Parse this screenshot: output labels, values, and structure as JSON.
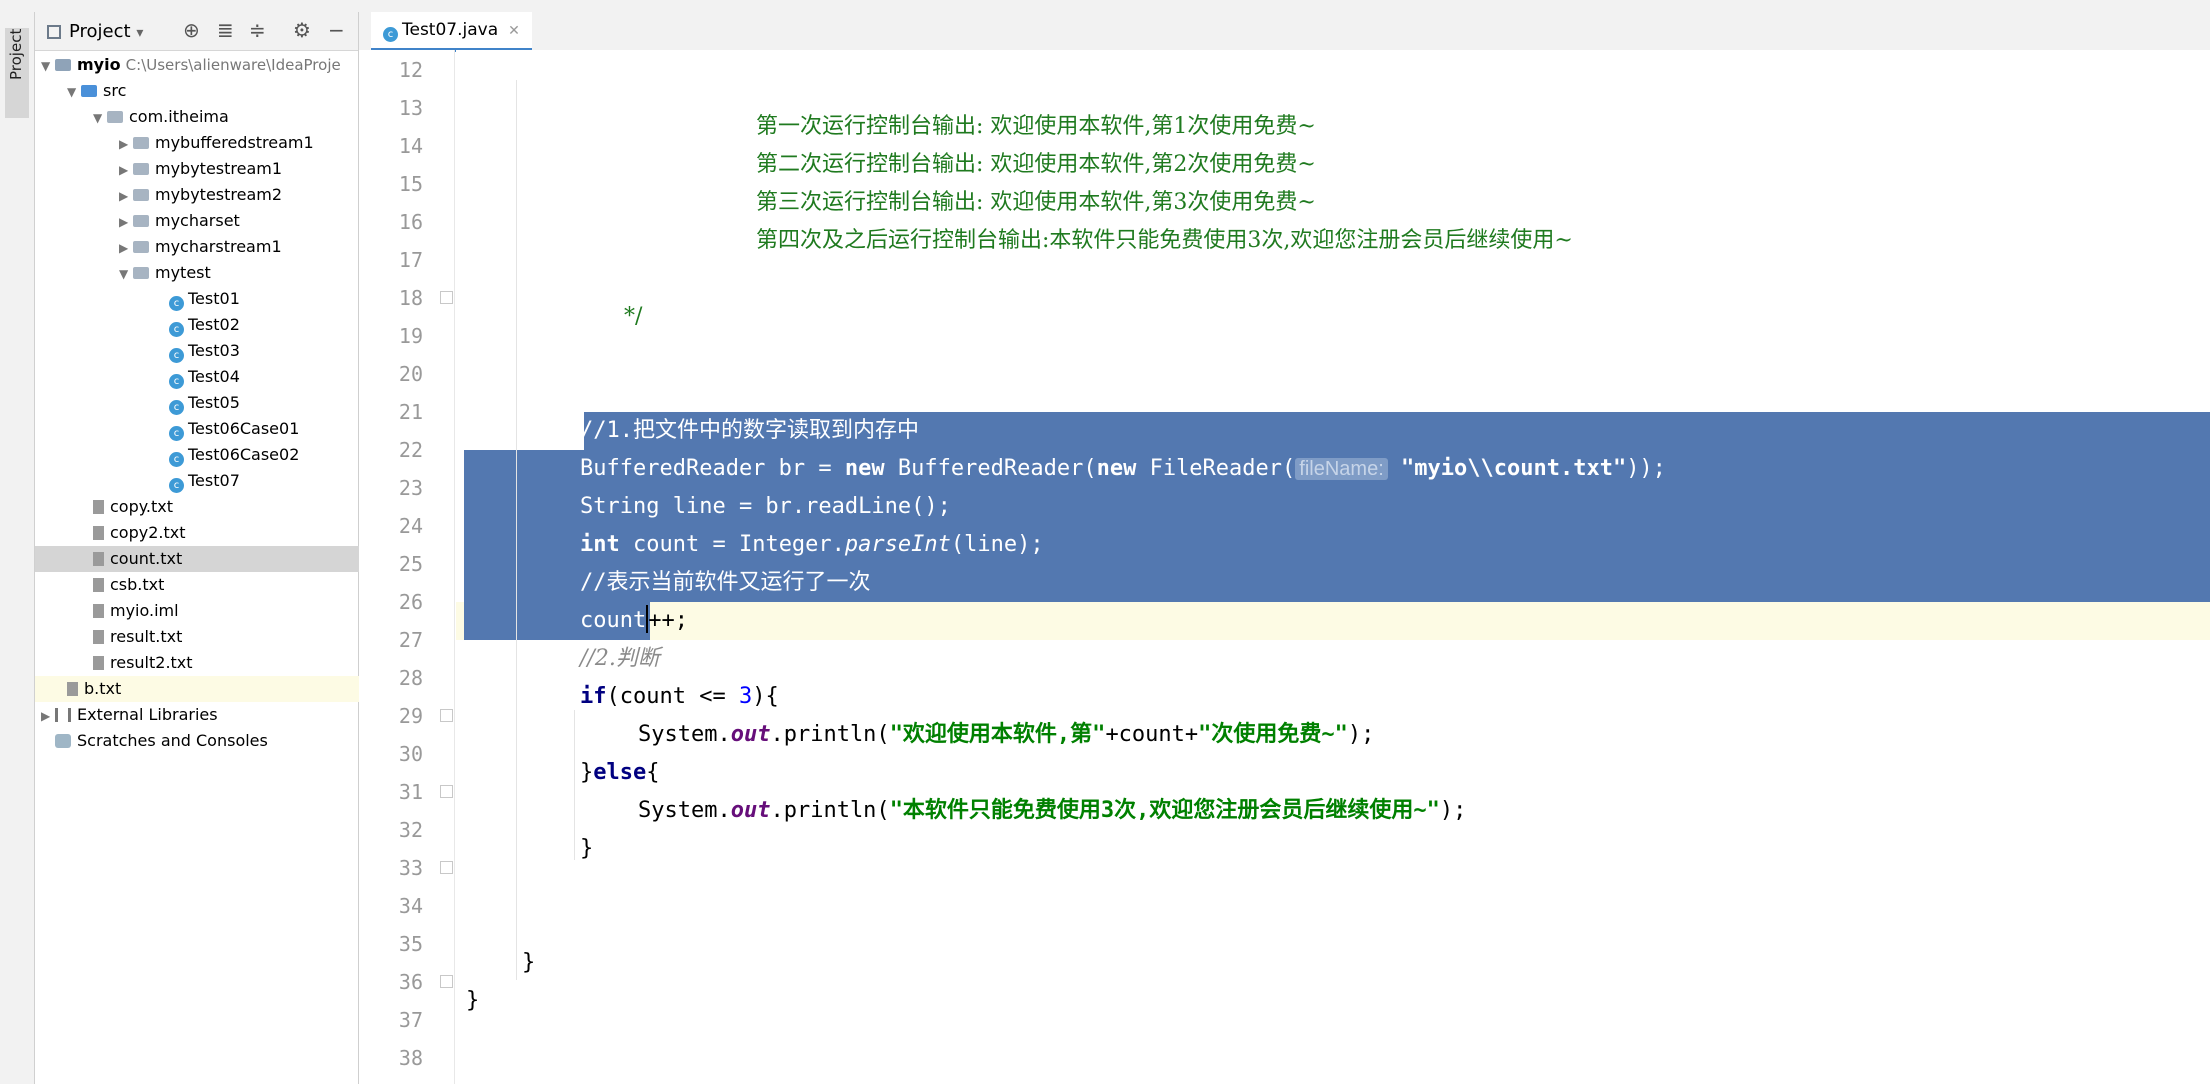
{
  "toolbar": {
    "title": "Project",
    "dropdown_glyph": "▾",
    "icons": [
      "locate-icon",
      "expand-all-icon",
      "collapse-all-icon",
      "gear-icon",
      "minimize-icon"
    ]
  },
  "side_tab": {
    "label": "Project"
  },
  "tree": {
    "root": {
      "name": "myio",
      "path": "C:\\Users\\alienware\\IdeaProje"
    },
    "src": "src",
    "package": "com.itheima",
    "subpackages": [
      "mybufferedstream1",
      "mybytestream1",
      "mybytestream2",
      "mycharset",
      "mycharstream1",
      "mytest"
    ],
    "classes": [
      "Test01",
      "Test02",
      "Test03",
      "Test04",
      "Test05",
      "Test06Case01",
      "Test06Case02",
      "Test07"
    ],
    "files": [
      "copy.txt",
      "copy2.txt",
      "count.txt",
      "csb.txt",
      "myio.iml",
      "result.txt",
      "result2.txt"
    ],
    "b_file": "b.txt",
    "external_libraries": "External Libraries",
    "scratches": "Scratches and Consoles"
  },
  "editor": {
    "tab_label": "Test07.java",
    "line_numbers": [
      "12",
      "13",
      "14",
      "15",
      "16",
      "17",
      "18",
      "19",
      "20",
      "21",
      "22",
      "23",
      "24",
      "25",
      "26",
      "27",
      "28",
      "29",
      "30",
      "31",
      "32",
      "33",
      "34",
      "35",
      "36",
      "37",
      "38"
    ],
    "lines": {
      "l13": "第一次运行控制台输出: 欢迎使用本软件,第1次使用免费~",
      "l14": "第二次运行控制台输出: 欢迎使用本软件,第2次使用免费~",
      "l15": "第三次运行控制台输出: 欢迎使用本软件,第3次使用免费~",
      "l16": "第四次及之后运行控制台输出:本软件只能免费使用3次,欢迎您注册会员后继续使用~",
      "l18": "*/",
      "l22": "//1.把文件中的数字读取到内存中",
      "l23_a": "BufferedReader br = ",
      "l23_kw": "new",
      "l23_b": " BufferedReader(",
      "l23_c": " FileReader(",
      "l23_hint": "fileName:",
      "l23_str": "\"myio\\\\count.txt\"",
      "l23_end": "));",
      "l24": "String line = br.readLine();",
      "l25_kw": "int",
      "l25_a": " count = Integer.",
      "l25_st": "parseInt",
      "l25_b": "(line);",
      "l26": "//表示当前软件又运行了一次",
      "l27_a": "count",
      "l27_b": "++;",
      "l28": "//2.判断",
      "l29_kw": "if",
      "l29_a": "(count <= ",
      "l29_num": "3",
      "l29_b": "){",
      "l30_a": "System.",
      "l30_fld": "out",
      "l30_b": ".println(",
      "l30_str1": "\"欢迎使用本软件,第\"",
      "l30_c": "+count+",
      "l30_str2": "\"次使用免费~\"",
      "l30_end": ");",
      "l31_a": "}",
      "l31_kw": "else",
      "l31_b": "{",
      "l32_a": "System.",
      "l32_fld": "out",
      "l32_b": ".println(",
      "l32_str": "\"本软件只能免费使用3次,欢迎您注册会员后继续使用~\"",
      "l32_end": ");",
      "l33": "}",
      "l36": "}",
      "l37": "}"
    }
  }
}
